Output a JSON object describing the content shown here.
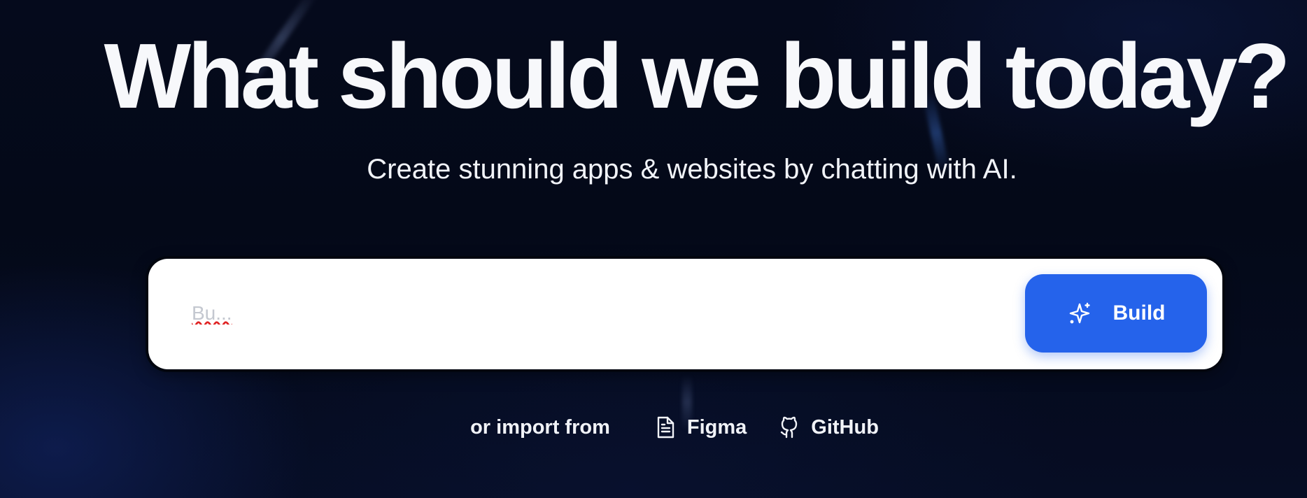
{
  "hero": {
    "title": "What should we build today?",
    "subtitle": "Create stunning apps & websites by chatting with AI."
  },
  "prompt": {
    "placeholder": "Bu...",
    "value": "",
    "build_icon": "sparkles-icon",
    "build_label": "Build",
    "build_color": "#2563eb"
  },
  "import": {
    "label": "or import from",
    "links": [
      {
        "label": "Figma",
        "icon": "file-icon"
      },
      {
        "label": "GitHub",
        "icon": "github-icon"
      }
    ]
  },
  "colors": {
    "background": "#050a1e",
    "text": "#f7f8fb"
  }
}
